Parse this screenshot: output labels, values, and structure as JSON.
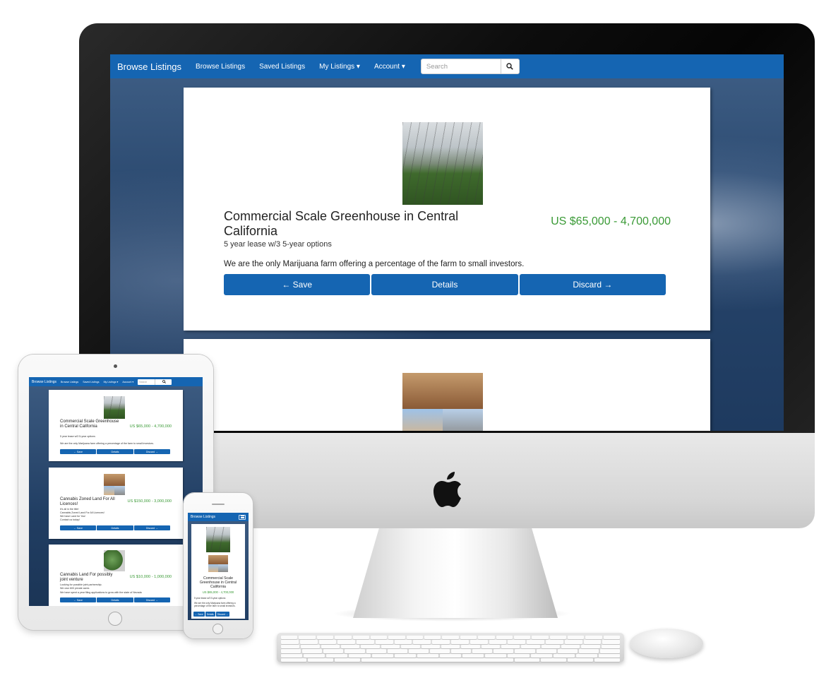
{
  "desktop": {
    "nav": {
      "brand": "Browse Listings",
      "links": [
        "Browse Listings",
        "Saved Listings",
        "My Listings ▾",
        "Account ▾"
      ],
      "search_placeholder": "Search"
    },
    "listing": {
      "title": "Commercial Scale Greenhouse in Central California",
      "subtitle": "5 year lease w/3 5-year options",
      "price": "US $65,000 - 4,700,000",
      "description": "We are the only Marijuana farm offering a percentage of the farm to small investors.",
      "buttons": [
        "← Save",
        "Details",
        "Discard →"
      ]
    }
  },
  "tablet": {
    "nav": {
      "brand": "Browse Listings",
      "links": [
        "Browse Listings",
        "Saved Listings",
        "My Listings ▾",
        "Account ▾"
      ],
      "search_placeholder": "Search"
    },
    "listings": [
      {
        "title": "Commercial Scale Greenhouse in Central California",
        "lines": [
          "5 year lease w/3 5-year options",
          "",
          "We are the only Marijuana farm offering a percentage of the farm to small investors."
        ],
        "price": "US $65,000 - 4,700,000"
      },
      {
        "title": "Cannabis Zoned Land For All Licences!",
        "lines": [
          "It's all in the title!",
          "Cannabis Zoned Land For All Licences!",
          "We have Land for You!",
          "Contact us today!"
        ],
        "price": "US $150,000 - 3,000,000"
      },
      {
        "title": "Cannabis Land For possibly joint venture",
        "lines": [
          "Looking for possible joint partnership.",
          "We own 600 private acres",
          "We have spent a year filing applications to grow with the state of Nevada"
        ],
        "price": "US $10,000 - 1,000,000"
      }
    ],
    "buttons": [
      "← Save",
      "Details",
      "Discard →"
    ]
  },
  "phone": {
    "nav": {
      "brand": "Browse Listings"
    },
    "listing": {
      "title": "Commercial Scale Greenhouse in Central California",
      "price": "US $65,000 - 4,700,000",
      "subtitle": "5 year lease w/3 5-year options",
      "description": "We are the only Marijuana farm offering a percentage of the farm to small investors.",
      "buttons": [
        "← Save",
        "Details",
        "Discard →"
      ]
    }
  },
  "colors": {
    "brand_blue": "#1565b2",
    "price_green": "#3a9a36"
  }
}
